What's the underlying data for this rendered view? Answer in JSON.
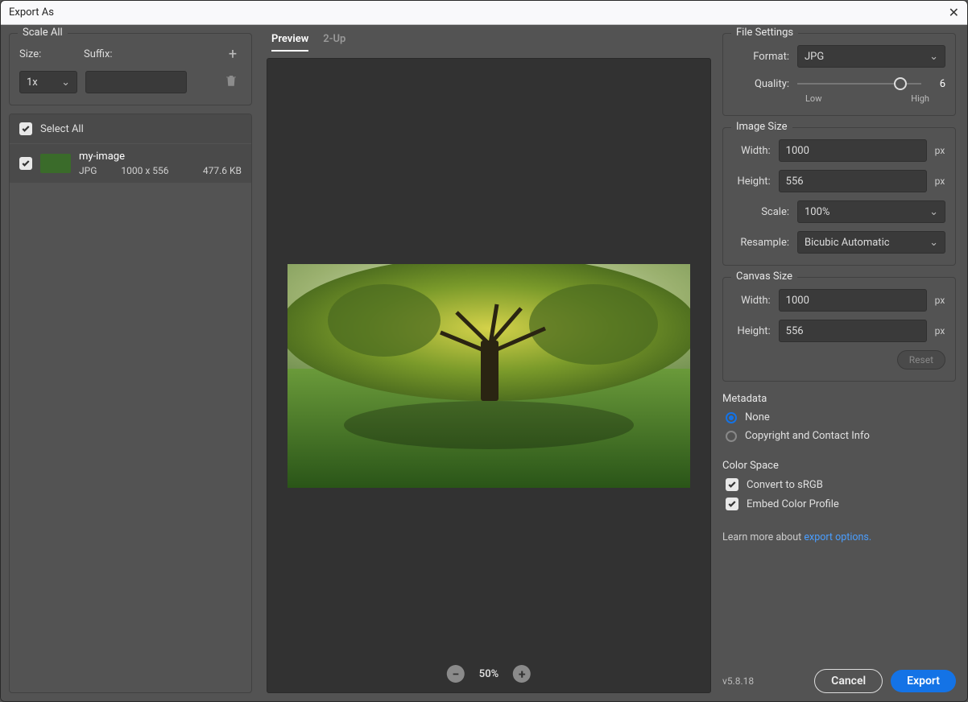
{
  "window": {
    "title": "Export As"
  },
  "scaleAll": {
    "legend": "Scale All",
    "sizeLabel": "Size:",
    "suffixLabel": "Suffix:",
    "sizeValue": "1x",
    "suffixValue": ""
  },
  "assets": {
    "selectAllLabel": "Select All",
    "items": [
      {
        "name": "my-image",
        "format": "JPG",
        "dimensions": "1000 x 556",
        "size": "477.6 KB"
      }
    ]
  },
  "tabs": {
    "preview": "Preview",
    "twoUp": "2-Up"
  },
  "zoom": {
    "level": "50%"
  },
  "fileSettings": {
    "legend": "File Settings",
    "formatLabel": "Format:",
    "formatValue": "JPG",
    "qualityLabel": "Quality:",
    "qualityValue": "6",
    "qualityLow": "Low",
    "qualityHigh": "High"
  },
  "imageSize": {
    "legend": "Image Size",
    "widthLabel": "Width:",
    "widthValue": "1000",
    "heightLabel": "Height:",
    "heightValue": "556",
    "scaleLabel": "Scale:",
    "scaleValue": "100%",
    "resampleLabel": "Resample:",
    "resampleValue": "Bicubic Automatic",
    "unit": "px"
  },
  "canvasSize": {
    "legend": "Canvas Size",
    "widthLabel": "Width:",
    "widthValue": "1000",
    "heightLabel": "Height:",
    "heightValue": "556",
    "unit": "px",
    "reset": "Reset"
  },
  "metadata": {
    "title": "Metadata",
    "none": "None",
    "contact": "Copyright and Contact Info"
  },
  "colorSpace": {
    "title": "Color Space",
    "srgb": "Convert to sRGB",
    "embed": "Embed Color Profile"
  },
  "learn": {
    "prefix": "Learn more about ",
    "link": "export options."
  },
  "footer": {
    "version": "v5.8.18",
    "cancel": "Cancel",
    "export": "Export"
  }
}
